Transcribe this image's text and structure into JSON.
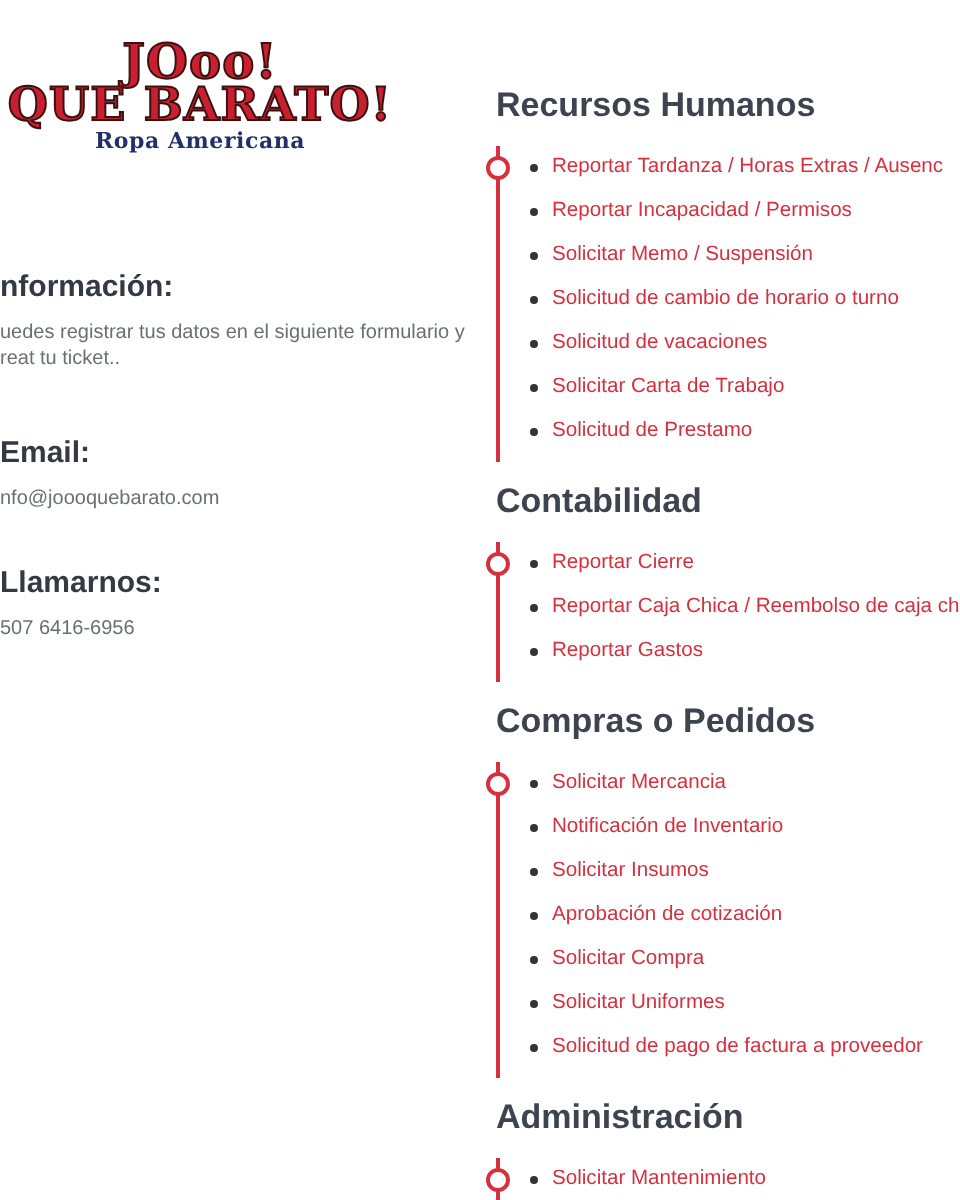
{
  "logo": {
    "lines": [
      "JOoo!",
      "QUE BARATO!",
      "Ropa Americana"
    ]
  },
  "contact": [
    {
      "heading": "nformación:",
      "lines": [
        "uedes registrar tus datos en el siguiente formulario y",
        "reat tu ticket.."
      ]
    },
    {
      "heading": "Email:",
      "lines": [
        "nfo@joooquebarato.com"
      ]
    },
    {
      "heading": "Llamarnos:",
      "lines": [
        "507 6416-6956"
      ]
    }
  ],
  "categories": [
    {
      "title": "Recursos Humanos",
      "items": [
        "Reportar Tardanza / Horas Extras / Ausenc",
        "Reportar Incapacidad / Permisos",
        "Solicitar Memo / Suspensión",
        "Solicitud de cambio de horario o turno",
        "Solicitud de vacaciones",
        "Solicitar Carta de Trabajo",
        "Solicitud de Prestamo"
      ]
    },
    {
      "title": "Contabilidad",
      "items": [
        "Reportar Cierre",
        "Reportar Caja Chica / Reembolso de caja ch",
        "Reportar Gastos"
      ]
    },
    {
      "title": "Compras o Pedidos",
      "items": [
        "Solicitar Mercancia",
        "Notificación de Inventario",
        "Solicitar Insumos",
        "Aprobación de cotización",
        "Solicitar Compra",
        "Solicitar Uniformes",
        "Solicitud de pago de factura a proveedor"
      ]
    },
    {
      "title": "Administración",
      "items": [
        "Solicitar Mantenimiento"
      ]
    }
  ]
}
